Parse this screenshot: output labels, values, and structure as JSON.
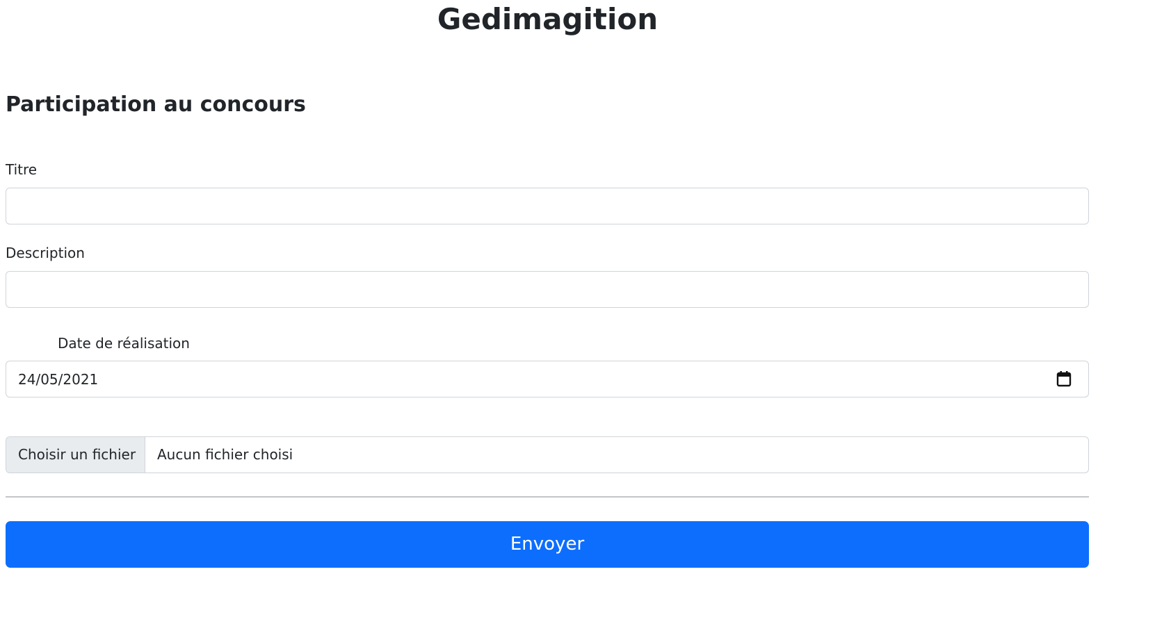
{
  "app": {
    "title": "Gedimagition"
  },
  "form": {
    "heading": "Participation au concours",
    "title_field": {
      "label": "Titre",
      "value": ""
    },
    "description_field": {
      "label": "Description",
      "value": ""
    },
    "date_field": {
      "label": "Date de réalisation",
      "value": "24/05/2021",
      "icon": "calendar-icon"
    },
    "file_field": {
      "button_label": "Choisir un fichier",
      "status": "Aucun fichier choisi"
    },
    "submit": {
      "label": "Envoyer"
    }
  },
  "colors": {
    "primary": "#0d6efd",
    "text": "#212529",
    "border": "#ced4da",
    "file_button_bg": "#e9ecef",
    "divider": "#c2c5c9"
  }
}
